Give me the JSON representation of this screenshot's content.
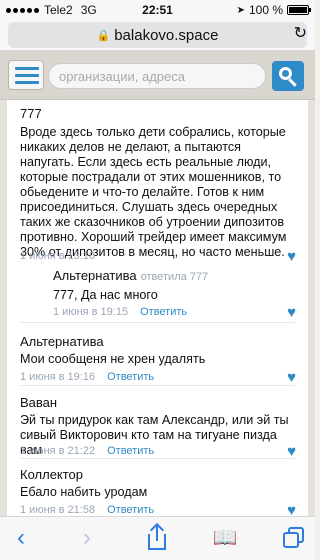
{
  "status_bar": {
    "carrier": "Tele2",
    "network": "3G",
    "time": "22:51",
    "battery": "100 %"
  },
  "browser": {
    "url": "balakovo.space"
  },
  "search": {
    "placeholder": "организации, адреса"
  },
  "comments": [
    {
      "author": "777",
      "text": "Вроде здесь только дети собрались, которые никаких делов не делают, а пытаются напугать. Если здесь есть реальные люди, которые пострадали от этих мошенников, то обьедените и что-то делайте. Готов к ним присоединиться. Слушать здесь очередных таких же сказочников об утроении дипозитов противно. Хороший трейдер имеет максимум 30% от дипозитов в месяц, но часто меньше.",
      "date": "1 июня в 13:10"
    },
    {
      "author": "Альтернатива",
      "replied_to": "ответила 777",
      "text": "777, Да нас много",
      "date": "1 июня в 19:15",
      "reply_label": "Ответить"
    },
    {
      "author": "Альтернатива",
      "text": "Мои сообщеня не хрен удалять",
      "date": "1 июня в 19:16",
      "reply_label": "Ответить"
    },
    {
      "author": "Ваван",
      "text": "Эй ты придурок как там Александр, или эй ты сивый Викторович кто там на тигуане пизда вам",
      "date": "1 июня в 21:22",
      "reply_label": "Ответить"
    },
    {
      "author": "Коллектор",
      "text": "Ебало набить уродам",
      "date": "1 июня в 21:58",
      "reply_label": "Ответить"
    }
  ],
  "icons": {
    "heart": "heart-icon",
    "back": "chevron-left-icon",
    "forward": "chevron-right-icon",
    "share": "share-icon",
    "bookmarks": "book-icon",
    "tabs": "tabs-icon"
  },
  "colors": {
    "accent": "#2f8ac8",
    "meta": "#9aa7b6"
  }
}
